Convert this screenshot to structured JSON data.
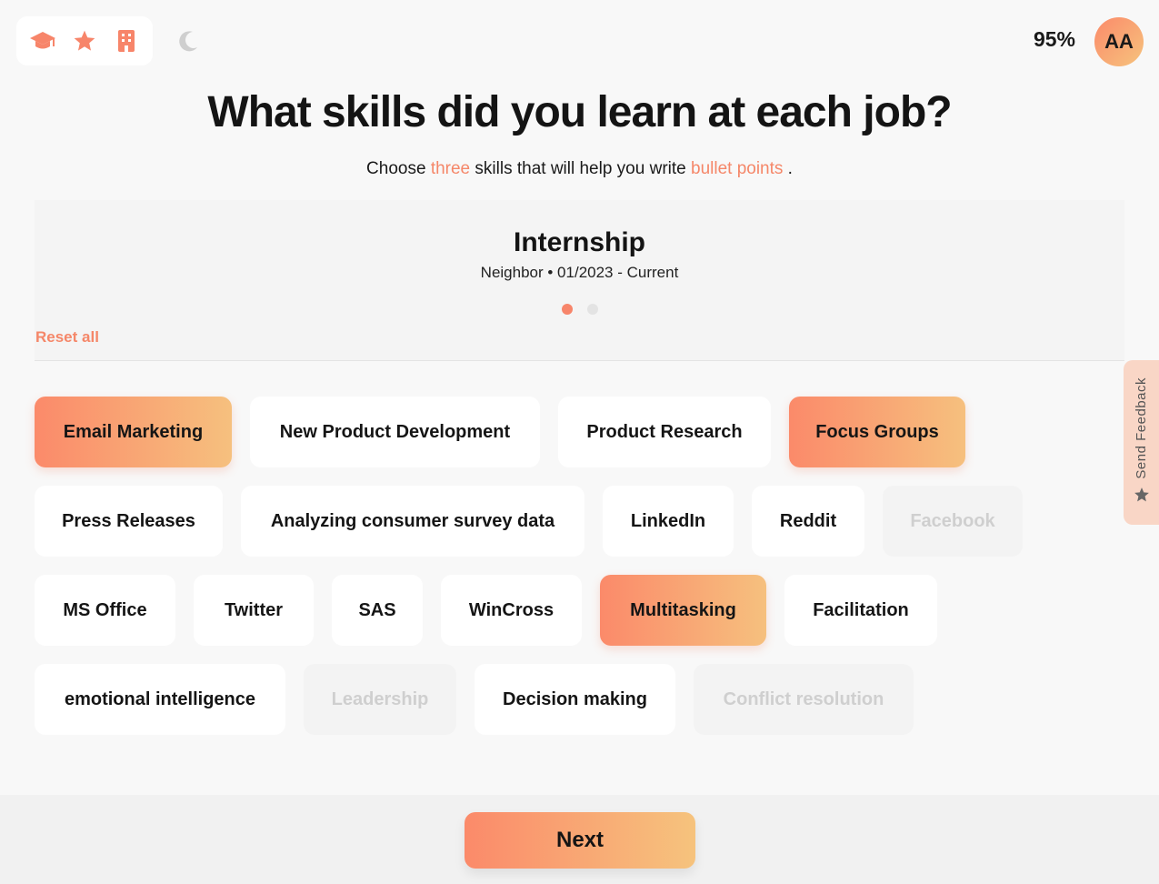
{
  "toolbar": {
    "icons": [
      "graduation-cap-icon",
      "star-icon",
      "building-icon"
    ],
    "theme_icon": "moon-icon"
  },
  "header": {
    "progress": "95%",
    "avatar_initials": "AA"
  },
  "page": {
    "title": "What skills did you learn at each job?",
    "subtitle_prefix": "Choose ",
    "subtitle_highlight1": "three",
    "subtitle_middle": " skills that will help you write ",
    "subtitle_highlight2": "bullet points",
    "subtitle_suffix": " ."
  },
  "job": {
    "title": "Internship",
    "meta": "Neighbor • 01/2023 - Current",
    "pages_total": 2,
    "pages_active": 1,
    "reset_label": "Reset all"
  },
  "skills": [
    {
      "label": "Email Marketing",
      "state": "selected"
    },
    {
      "label": "New Product Development",
      "state": "normal"
    },
    {
      "label": "Product Research",
      "state": "normal"
    },
    {
      "label": "Focus Groups",
      "state": "selected"
    },
    {
      "label": "Press Releases",
      "state": "normal"
    },
    {
      "label": "Analyzing consumer survey data",
      "state": "normal"
    },
    {
      "label": "LinkedIn",
      "state": "normal"
    },
    {
      "label": "Reddit",
      "state": "normal"
    },
    {
      "label": "Facebook",
      "state": "disabled"
    },
    {
      "label": "MS Office",
      "state": "normal"
    },
    {
      "label": "Twitter",
      "state": "normal"
    },
    {
      "label": "SAS",
      "state": "normal"
    },
    {
      "label": "WinCross",
      "state": "normal"
    },
    {
      "label": "Multitasking",
      "state": "selected"
    },
    {
      "label": "Facilitation",
      "state": "normal"
    },
    {
      "label": "emotional intelligence",
      "state": "normal"
    },
    {
      "label": "Leadership",
      "state": "disabled"
    },
    {
      "label": "Decision making",
      "state": "normal"
    },
    {
      "label": "Conflict resolution",
      "state": "disabled"
    }
  ],
  "footer": {
    "next_label": "Next"
  },
  "feedback": {
    "label": "Send Feedback"
  },
  "colors": {
    "accent": "#f58769",
    "gradient_start": "#fb8a6a",
    "gradient_end": "#f6c37d"
  }
}
